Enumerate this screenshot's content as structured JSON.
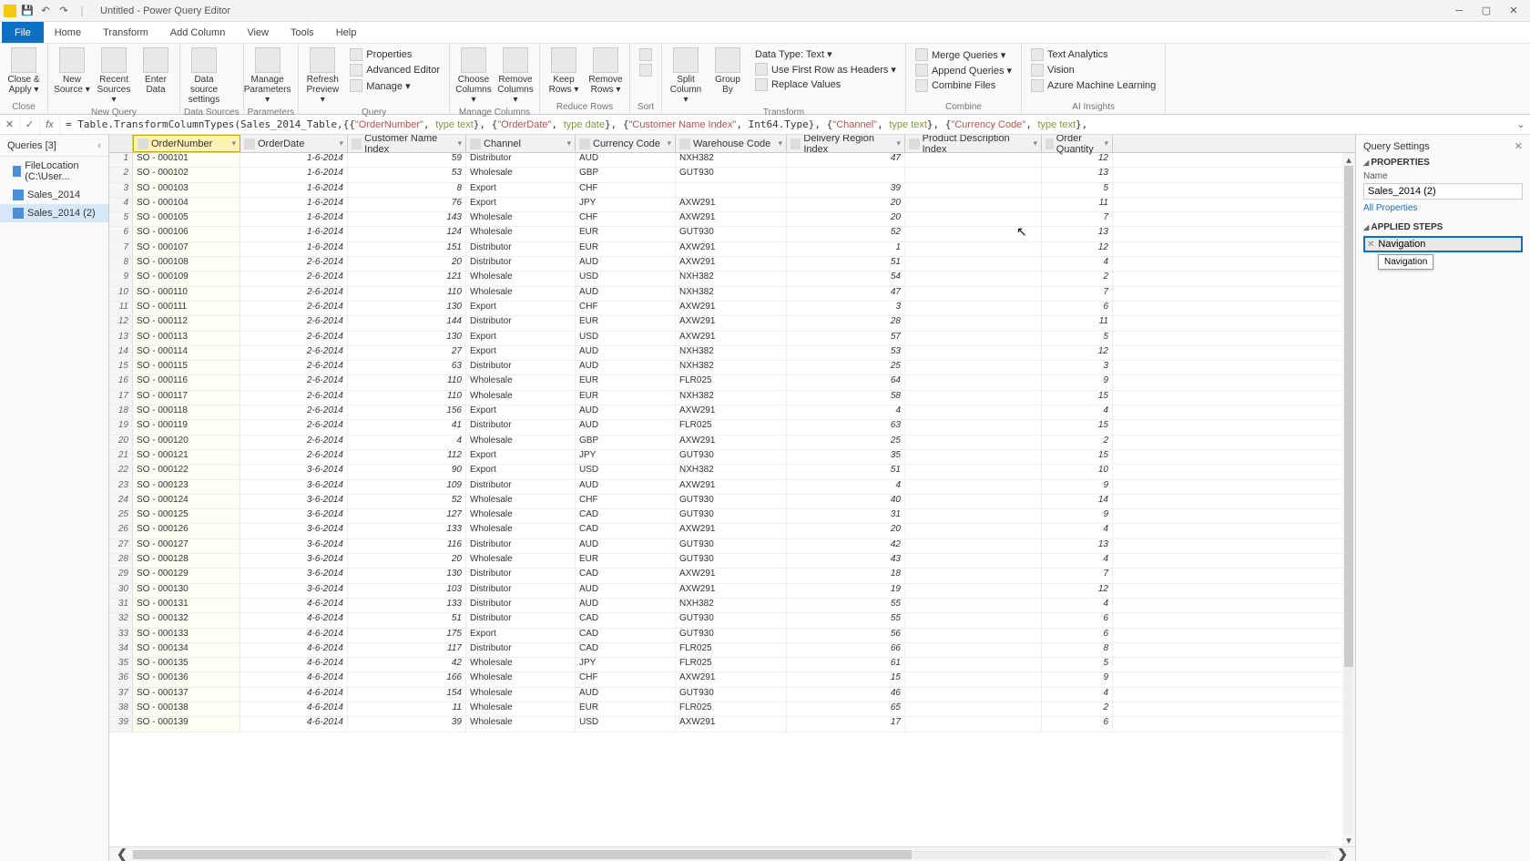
{
  "window": {
    "title": "Untitled - Power Query Editor"
  },
  "menu": {
    "file": "File",
    "home": "Home",
    "transform": "Transform",
    "addcol": "Add Column",
    "view": "View",
    "tools": "Tools",
    "help": "Help"
  },
  "ribbon": {
    "close": {
      "label": "Close &\nApply ▾",
      "group": "Close"
    },
    "newq": {
      "newsrc": "New\nSource ▾",
      "recent": "Recent\nSources ▾",
      "enter": "Enter\nData",
      "group": "New Query"
    },
    "ds": {
      "dss": "Data source\nsettings",
      "group": "Data Sources"
    },
    "params": {
      "mp": "Manage\nParameters ▾",
      "group": "Parameters"
    },
    "query": {
      "refresh": "Refresh\nPreview ▾",
      "props": "Properties",
      "adv": "Advanced Editor",
      "manage": "Manage ▾",
      "group": "Query"
    },
    "mcols": {
      "choose": "Choose\nColumns ▾",
      "remove": "Remove\nColumns ▾",
      "group": "Manage Columns"
    },
    "rrows": {
      "keep": "Keep\nRows ▾",
      "remove": "Remove\nRows ▾",
      "group": "Reduce Rows"
    },
    "sort": {
      "group": "Sort"
    },
    "transform": {
      "split": "Split\nColumn ▾",
      "groupby": "Group\nBy",
      "dtype": "Data Type: Text ▾",
      "firstrow": "Use First Row as Headers ▾",
      "replace": "Replace Values",
      "group": "Transform"
    },
    "combine": {
      "merge": "Merge Queries ▾",
      "append": "Append Queries ▾",
      "files": "Combine Files",
      "group": "Combine"
    },
    "ai": {
      "text": "Text Analytics",
      "vision": "Vision",
      "ml": "Azure Machine Learning",
      "group": "AI Insights"
    }
  },
  "formula": {
    "prefix": "= Table.TransformColumnTypes(Sales_2014_Table,{{",
    "parts": [
      "\"OrderNumber\"",
      "type text",
      "\"OrderDate\"",
      "type date",
      "\"Customer Name Index\"",
      "Int64.Type",
      "\"Channel\"",
      "type text",
      "\"Currency Code\"",
      "type text"
    ]
  },
  "queries": {
    "header": "Queries [3]",
    "items": [
      {
        "label": "FileLocation (C:\\User..."
      },
      {
        "label": "Sales_2014"
      },
      {
        "label": "Sales_2014 (2)",
        "selected": true
      }
    ]
  },
  "columns": [
    {
      "name": "OrderNumber",
      "type": "ABC",
      "sel": true
    },
    {
      "name": "OrderDate",
      "type": "📅"
    },
    {
      "name": "Customer Name Index",
      "type": "123"
    },
    {
      "name": "Channel",
      "type": "ABC"
    },
    {
      "name": "Currency Code",
      "type": "ABC"
    },
    {
      "name": "Warehouse Code",
      "type": "ABC"
    },
    {
      "name": "Delivery Region Index",
      "type": "123"
    },
    {
      "name": "Product Description Index",
      "type": "123"
    },
    {
      "name": "Order Quantity",
      "type": "123"
    }
  ],
  "rows": [
    [
      "SO - 000101",
      "1-6-2014",
      "59",
      "Distributor",
      "AUD",
      "NXH382",
      "47",
      "",
      "12"
    ],
    [
      "SO - 000102",
      "1-6-2014",
      "53",
      "Wholesale",
      "GBP",
      "GUT930",
      "",
      "",
      "13"
    ],
    [
      "SO - 000103",
      "1-6-2014",
      "8",
      "Export",
      "CHF",
      "",
      "39",
      "",
      "5"
    ],
    [
      "SO - 000104",
      "1-6-2014",
      "76",
      "Export",
      "JPY",
      "AXW291",
      "20",
      "",
      "11"
    ],
    [
      "SO - 000105",
      "1-6-2014",
      "143",
      "Wholesale",
      "CHF",
      "AXW291",
      "20",
      "",
      "7"
    ],
    [
      "SO - 000106",
      "1-6-2014",
      "124",
      "Wholesale",
      "EUR",
      "GUT930",
      "52",
      "",
      "13"
    ],
    [
      "SO - 000107",
      "1-6-2014",
      "151",
      "Distributor",
      "EUR",
      "AXW291",
      "1",
      "",
      "12"
    ],
    [
      "SO - 000108",
      "2-6-2014",
      "20",
      "Distributor",
      "AUD",
      "AXW291",
      "51",
      "",
      "4"
    ],
    [
      "SO - 000109",
      "2-6-2014",
      "121",
      "Wholesale",
      "USD",
      "NXH382",
      "54",
      "",
      "2"
    ],
    [
      "SO - 000110",
      "2-6-2014",
      "110",
      "Wholesale",
      "AUD",
      "NXH382",
      "47",
      "",
      "7"
    ],
    [
      "SO - 000111",
      "2-6-2014",
      "130",
      "Export",
      "CHF",
      "AXW291",
      "3",
      "",
      "6"
    ],
    [
      "SO - 000112",
      "2-6-2014",
      "144",
      "Distributor",
      "EUR",
      "AXW291",
      "28",
      "",
      "11"
    ],
    [
      "SO - 000113",
      "2-6-2014",
      "130",
      "Export",
      "USD",
      "AXW291",
      "57",
      "",
      "5"
    ],
    [
      "SO - 000114",
      "2-6-2014",
      "27",
      "Export",
      "AUD",
      "NXH382",
      "53",
      "",
      "12"
    ],
    [
      "SO - 000115",
      "2-6-2014",
      "63",
      "Distributor",
      "AUD",
      "NXH382",
      "25",
      "",
      "3"
    ],
    [
      "SO - 000116",
      "2-6-2014",
      "110",
      "Wholesale",
      "EUR",
      "FLR025",
      "64",
      "",
      "9"
    ],
    [
      "SO - 000117",
      "2-6-2014",
      "110",
      "Wholesale",
      "EUR",
      "NXH382",
      "58",
      "",
      "15"
    ],
    [
      "SO - 000118",
      "2-6-2014",
      "156",
      "Export",
      "AUD",
      "AXW291",
      "4",
      "",
      "4"
    ],
    [
      "SO - 000119",
      "2-6-2014",
      "41",
      "Distributor",
      "AUD",
      "FLR025",
      "63",
      "",
      "15"
    ],
    [
      "SO - 000120",
      "2-6-2014",
      "4",
      "Wholesale",
      "GBP",
      "AXW291",
      "25",
      "",
      "2"
    ],
    [
      "SO - 000121",
      "2-6-2014",
      "112",
      "Export",
      "JPY",
      "GUT930",
      "35",
      "",
      "15"
    ],
    [
      "SO - 000122",
      "3-6-2014",
      "90",
      "Export",
      "USD",
      "NXH382",
      "51",
      "",
      "10"
    ],
    [
      "SO - 000123",
      "3-6-2014",
      "109",
      "Distributor",
      "AUD",
      "AXW291",
      "4",
      "",
      "9"
    ],
    [
      "SO - 000124",
      "3-6-2014",
      "52",
      "Wholesale",
      "CHF",
      "GUT930",
      "40",
      "",
      "14"
    ],
    [
      "SO - 000125",
      "3-6-2014",
      "127",
      "Wholesale",
      "CAD",
      "GUT930",
      "31",
      "",
      "9"
    ],
    [
      "SO - 000126",
      "3-6-2014",
      "133",
      "Wholesale",
      "CAD",
      "AXW291",
      "20",
      "",
      "4"
    ],
    [
      "SO - 000127",
      "3-6-2014",
      "116",
      "Distributor",
      "AUD",
      "GUT930",
      "42",
      "",
      "13"
    ],
    [
      "SO - 000128",
      "3-6-2014",
      "20",
      "Wholesale",
      "EUR",
      "GUT930",
      "43",
      "",
      "4"
    ],
    [
      "SO - 000129",
      "3-6-2014",
      "130",
      "Distributor",
      "CAD",
      "AXW291",
      "18",
      "",
      "7"
    ],
    [
      "SO - 000130",
      "3-6-2014",
      "103",
      "Distributor",
      "AUD",
      "AXW291",
      "19",
      "",
      "12"
    ],
    [
      "SO - 000131",
      "4-6-2014",
      "133",
      "Distributor",
      "AUD",
      "NXH382",
      "55",
      "",
      "4"
    ],
    [
      "SO - 000132",
      "4-6-2014",
      "51",
      "Distributor",
      "CAD",
      "GUT930",
      "55",
      "",
      "6"
    ],
    [
      "SO - 000133",
      "4-6-2014",
      "175",
      "Export",
      "CAD",
      "GUT930",
      "56",
      "",
      "6"
    ],
    [
      "SO - 000134",
      "4-6-2014",
      "117",
      "Distributor",
      "CAD",
      "FLR025",
      "66",
      "",
      "8"
    ],
    [
      "SO - 000135",
      "4-6-2014",
      "42",
      "Wholesale",
      "JPY",
      "FLR025",
      "61",
      "",
      "5"
    ],
    [
      "SO - 000136",
      "4-6-2014",
      "166",
      "Wholesale",
      "CHF",
      "AXW291",
      "15",
      "",
      "9"
    ],
    [
      "SO - 000137",
      "4-6-2014",
      "154",
      "Wholesale",
      "AUD",
      "GUT930",
      "46",
      "",
      "4"
    ],
    [
      "SO - 000138",
      "4-6-2014",
      "11",
      "Wholesale",
      "EUR",
      "FLR025",
      "65",
      "",
      "2"
    ],
    [
      "SO - 000139",
      "4-6-2014",
      "39",
      "Wholesale",
      "USD",
      "AXW291",
      "17",
      "",
      "6"
    ]
  ],
  "settings": {
    "header": "Query Settings",
    "props": "PROPERTIES",
    "namelabel": "Name",
    "name": "Sales_2014 (2)",
    "allprops": "All Properties",
    "applied": "APPLIED STEPS",
    "steps": [
      {
        "label": "Navigation",
        "selected": true
      }
    ],
    "tooltip": "Navigation"
  }
}
